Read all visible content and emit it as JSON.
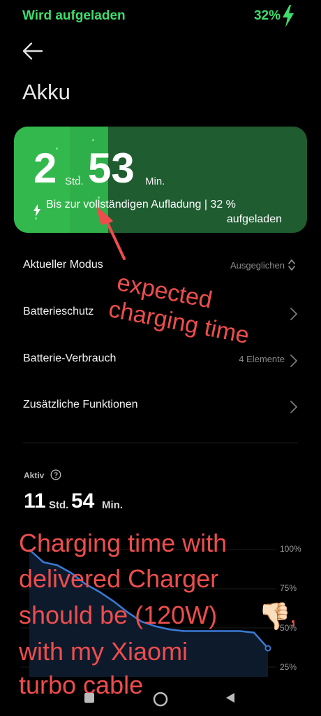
{
  "status_bar": {
    "left_text": "Wird aufgeladen",
    "battery_percent": "32%"
  },
  "header": {
    "title": "Akku"
  },
  "card": {
    "hours": "2",
    "hours_unit": "Std.",
    "minutes": "53",
    "minutes_unit": "Min.",
    "subtitle_line1": "Bis zur vollständigen Aufladung | 32 %",
    "subtitle_line2": "aufgeladen",
    "charge_fraction": 0.32,
    "accent_color": "#33b84e",
    "dark_color": "#1f5c30"
  },
  "settings": [
    {
      "label": "Aktueller Modus",
      "value": "Ausgeglichen",
      "control": "updown-icon"
    },
    {
      "label": "Batterieschutz",
      "value": "",
      "control": "chevron-right-icon"
    },
    {
      "label": "Batterie-Verbrauch",
      "value": "4 Elemente",
      "control": "chevron-right-icon"
    },
    {
      "label": "Zusätzliche Funktionen",
      "value": "",
      "control": "chevron-right-icon"
    }
  ],
  "active": {
    "label": "Aktiv",
    "hours": "11",
    "hours_unit": "Std.",
    "minutes": "54",
    "minutes_unit": "Min."
  },
  "chart_data": {
    "type": "line",
    "y_ticks": [
      "100%",
      "75%",
      "50%",
      "25%"
    ],
    "ylim": [
      25,
      100
    ],
    "x": [
      0,
      1,
      2,
      3,
      4,
      5,
      6,
      7,
      8,
      9,
      10,
      11,
      12,
      13,
      14,
      15,
      16,
      17
    ],
    "values": [
      100,
      92,
      90,
      85,
      78,
      73,
      67,
      60,
      54,
      51,
      49,
      48,
      48,
      48,
      48,
      48,
      47,
      37
    ],
    "line_color": "#3a7bd5"
  },
  "annotations": {
    "arrow_text_line1": "expected",
    "arrow_text_line2": "charging time",
    "bottom_lines": [
      "Charging time with",
      "delivered Charger",
      "should be (120W)",
      "with my Xiaomi",
      " turbo cable"
    ],
    "comma": ",",
    "thumb_emoji": "👎🏻"
  },
  "nav": {
    "recent": "recent-apps-icon",
    "home": "home-icon",
    "back": "back-icon"
  }
}
